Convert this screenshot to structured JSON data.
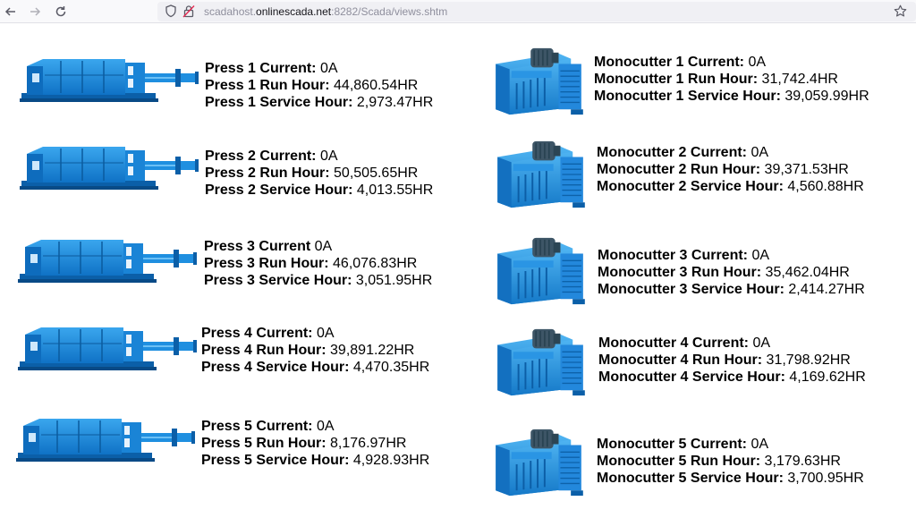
{
  "browser": {
    "url_host": "scadahost.",
    "url_domain": "onlinescada.net",
    "url_path": ":8282/Scada/views.shtm"
  },
  "presses": [
    {
      "current_label": "Press 1 Current: ",
      "current": "0A",
      "run_label": "Press 1 Run Hour: ",
      "run": "44,860.54HR",
      "service_label": "Press 1 Service Hour: ",
      "service": "2,973.47HR"
    },
    {
      "current_label": "Press 2 Current: ",
      "current": "0A",
      "run_label": "Press 2 Run Hour: ",
      "run": "50,505.65HR",
      "service_label": "Press 2 Service Hour: ",
      "service": "4,013.55HR"
    },
    {
      "current_label": "Press 3 Current ",
      "current": "0A",
      "run_label": "Press 3 Run Hour: ",
      "run": "46,076.83HR",
      "service_label": "Press 3 Service Hour: ",
      "service": "3,051.95HR"
    },
    {
      "current_label": "Press 4 Current: ",
      "current": "0A",
      "run_label": "Press 4 Run Hour: ",
      "run": "39,891.22HR",
      "service_label": "Press 4 Service Hour: ",
      "service": "4,470.35HR"
    },
    {
      "current_label": "Press 5 Current: ",
      "current": "0A",
      "run_label": "Press 5 Run Hour: ",
      "run": "8,176.97HR",
      "service_label": "Press 5 Service Hour: ",
      "service": "4,928.93HR"
    }
  ],
  "monocutters": [
    {
      "current_label": "Monocutter 1 Current: ",
      "current": "0A",
      "run_label": "Monocutter 1 Run Hour: ",
      "run": "31,742.4HR",
      "service_label": "Monocutter 1 Service Hour: ",
      "service": "39,059.99HR"
    },
    {
      "current_label": "Monocutter 2 Current: ",
      "current": "0A",
      "run_label": "Monocutter 2 Run Hour: ",
      "run": "39,371.53HR",
      "service_label": "Monocutter 2 Service Hour: ",
      "service": "4,560.88HR"
    },
    {
      "current_label": "Monocutter 3 Current: ",
      "current": "0A",
      "run_label": "Monocutter 3 Run Hour: ",
      "run": "35,462.04HR",
      "service_label": "Monocutter 3 Service Hour: ",
      "service": "2,414.27HR"
    },
    {
      "current_label": "Monocutter 4 Current: ",
      "current": "0A",
      "run_label": "Monocutter 4 Run Hour: ",
      "run": "31,798.92HR",
      "service_label": "Monocutter 4 Service Hour: ",
      "service": "4,169.62HR"
    },
    {
      "current_label": "Monocutter 5 Current: ",
      "current": "0A",
      "run_label": "Monocutter 5 Run Hour: ",
      "run": "3,179.63HR",
      "service_label": "Monocutter 5 Service Hour: ",
      "service": "3,700.95HR"
    }
  ],
  "colors": {
    "machine_blue": "#1f8fe0",
    "machine_dark": "#0b5fa8",
    "motor_gray": "#3d5566"
  },
  "icons": [
    "back-arrow-icon",
    "forward-arrow-icon",
    "reload-icon",
    "shield-icon",
    "insecure-lock-icon",
    "bookmark-star-icon",
    "press-machine-image",
    "monocutter-machine-image"
  ]
}
